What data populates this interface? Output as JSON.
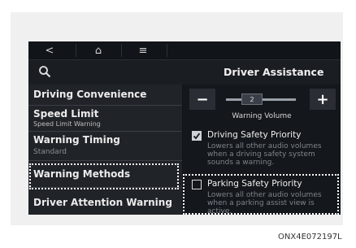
{
  "topbar": {
    "back": "<",
    "home": "⌂",
    "menu": "≡"
  },
  "header": {
    "title": "Driver Assistance"
  },
  "menu_items": [
    {
      "label": "Driving Convenience",
      "sub": ""
    },
    {
      "label": "Speed Limit",
      "sub": "Speed Limit Warning"
    },
    {
      "label": "Warning Timing",
      "sub": "Standard"
    },
    {
      "label": "Warning Methods",
      "sub": ""
    },
    {
      "label": "Driver Attention Warning",
      "sub": ""
    }
  ],
  "volume": {
    "minus": "−",
    "plus": "+",
    "value": "2",
    "label": "Warning Volume"
  },
  "options": [
    {
      "title": "Driving Safety Priority",
      "desc": "Lowers all other audio volumes when a driving safety system sounds a warning.",
      "checked": true
    },
    {
      "title": "Parking Safety Priority",
      "desc": "Lowers all other audio volumes when a parking assist view is active.",
      "checked": false
    }
  ],
  "caption": "ONX4E072197L"
}
